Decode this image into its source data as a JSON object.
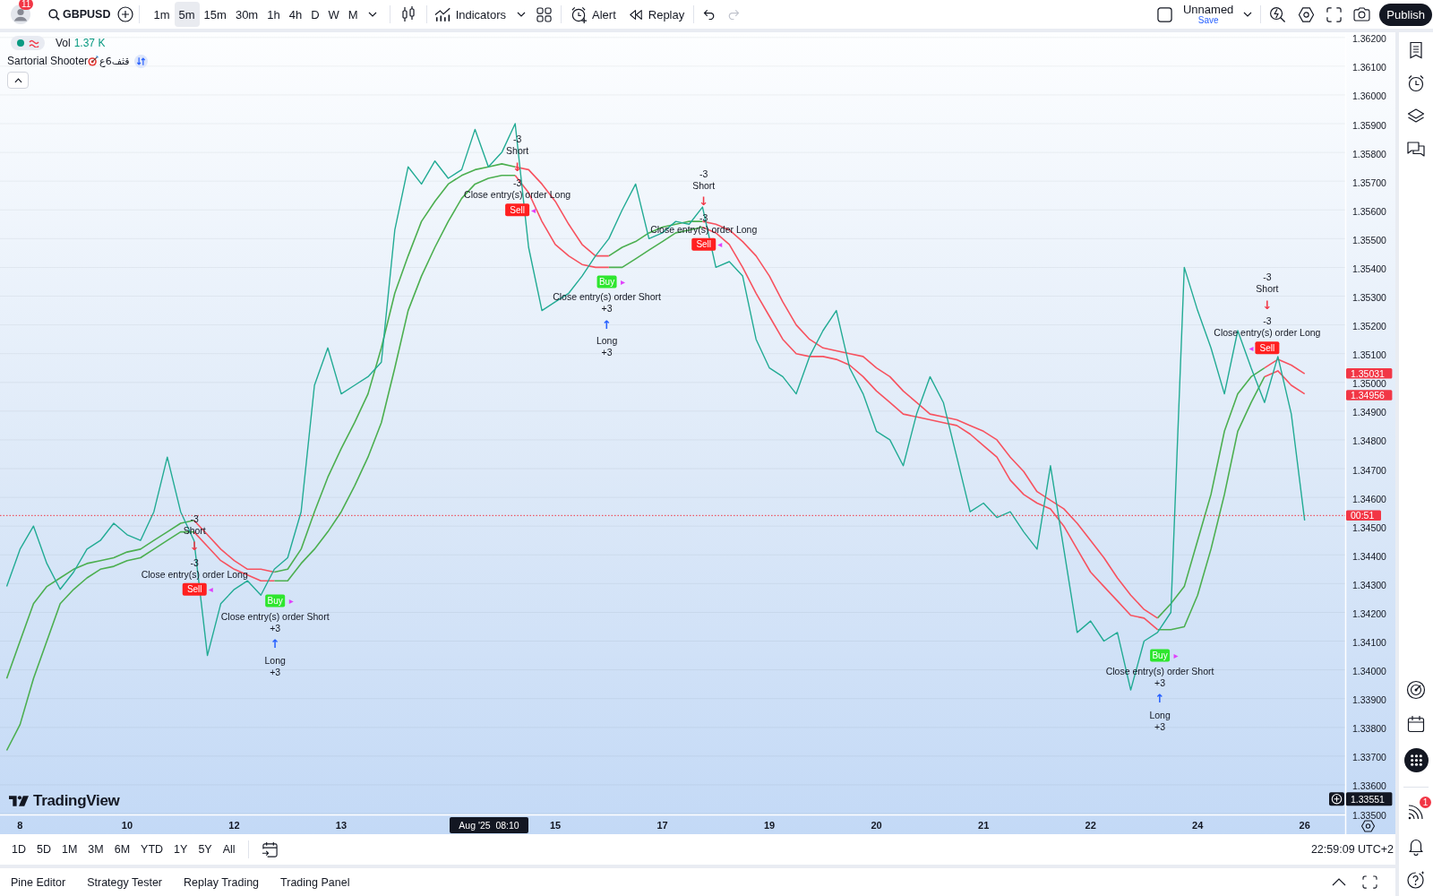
{
  "toolbar": {
    "notification_count": "11",
    "symbol": "GBPUSD",
    "intervals": [
      {
        "label": "1m",
        "selected": false
      },
      {
        "label": "5m",
        "selected": true
      },
      {
        "label": "15m",
        "selected": false
      },
      {
        "label": "30m",
        "selected": false
      },
      {
        "label": "1h",
        "selected": false
      },
      {
        "label": "4h",
        "selected": false
      },
      {
        "label": "D",
        "selected": false
      },
      {
        "label": "W",
        "selected": false
      },
      {
        "label": "M",
        "selected": false
      }
    ],
    "indicators": "Indicators",
    "alert": "Alert",
    "replay": "Replay",
    "history": [
      {
        "kind": "undo",
        "disabled": false
      },
      {
        "kind": "redo",
        "disabled": true
      }
    ],
    "layout_name": "Unnamed",
    "save": "Save",
    "publish": "Publish"
  },
  "legend": {
    "volume_label": "Vol",
    "volume_value": "1.37 K",
    "strategy_name": "Sartorial Shooter",
    "strategy_suffix": "قثف6ع"
  },
  "chart": {
    "logo_text": "TradingView",
    "chart_data": {
      "type": "line",
      "grid": true,
      "ylim": [
        1.33497,
        1.36218
      ],
      "categories": [
        null,
        "8",
        null,
        null,
        null,
        null,
        null,
        null,
        null,
        "10",
        null,
        null,
        null,
        null,
        null,
        null,
        null,
        "12",
        null,
        null,
        null,
        null,
        null,
        null,
        null,
        "13",
        null,
        null,
        null,
        null,
        null,
        null,
        null,
        null,
        null,
        null,
        null,
        null,
        null,
        null,
        null,
        "15",
        null,
        null,
        null,
        null,
        null,
        null,
        null,
        "17",
        null,
        null,
        null,
        null,
        null,
        null,
        null,
        "19",
        null,
        null,
        null,
        null,
        null,
        null,
        null,
        "20",
        null,
        null,
        null,
        null,
        null,
        null,
        null,
        "21",
        null,
        null,
        null,
        null,
        null,
        null,
        null,
        "22",
        null,
        null,
        null,
        null,
        null,
        null,
        null,
        "24",
        null,
        null,
        null,
        null,
        null,
        null,
        null,
        "26"
      ],
      "yticks": [
        {
          "value": 1.362,
          "label": "1.36200"
        },
        {
          "value": 1.361,
          "label": "1.36100"
        },
        {
          "value": 1.36,
          "label": "1.36000"
        },
        {
          "value": 1.359,
          "label": "1.35900"
        },
        {
          "value": 1.358,
          "label": "1.35800"
        },
        {
          "value": 1.357,
          "label": "1.35700"
        },
        {
          "value": 1.356,
          "label": "1.35600"
        },
        {
          "value": 1.355,
          "label": "1.35500"
        },
        {
          "value": 1.354,
          "label": "1.35400"
        },
        {
          "value": 1.353,
          "label": "1.35300"
        },
        {
          "value": 1.352,
          "label": "1.35200"
        },
        {
          "value": 1.351,
          "label": "1.35100"
        },
        {
          "value": 1.35,
          "label": "1.35000"
        },
        {
          "value": 1.349,
          "label": "1.34900"
        },
        {
          "value": 1.348,
          "label": "1.34800"
        },
        {
          "value": 1.347,
          "label": "1.34700"
        },
        {
          "value": 1.346,
          "label": "1.34600"
        },
        {
          "value": 1.345,
          "label": "1.34500"
        },
        {
          "value": 1.344,
          "label": "1.34400"
        },
        {
          "value": 1.343,
          "label": "1.34300"
        },
        {
          "value": 1.342,
          "label": "1.34200"
        },
        {
          "value": 1.341,
          "label": "1.34100"
        },
        {
          "value": 1.34,
          "label": "1.34000"
        },
        {
          "value": 1.339,
          "label": "1.33900"
        },
        {
          "value": 1.338,
          "label": "1.33800"
        },
        {
          "value": 1.337,
          "label": "1.33700"
        },
        {
          "value": 1.336,
          "label": "1.33600"
        },
        {
          "value": 1.335,
          "label": "1.33500"
        }
      ],
      "series": [
        {
          "color": "#22ab94",
          "values": [
            1.3429,
            1.3442,
            1.345,
            1.3437,
            1.3428,
            1.3434,
            1.3442,
            1.3445,
            1.3451,
            1.3447,
            1.3445,
            1.3455,
            1.3474,
            1.3455,
            1.3445,
            1.3405,
            1.3423,
            1.3428,
            1.3431,
            1.3426,
            1.3435,
            1.3439,
            1.3455,
            1.3499,
            1.3512,
            1.3496,
            1.3499,
            1.3502,
            1.3507,
            1.3553,
            1.3575,
            1.3569,
            1.3577,
            1.3571,
            1.3574,
            1.3588,
            1.3575,
            1.358,
            1.359,
            1.3547,
            1.3525,
            1.3528,
            1.3531,
            1.3537,
            1.3544,
            1.355,
            1.356,
            1.3569,
            1.355,
            1.3552,
            1.3556,
            1.3555,
            1.3561,
            1.354,
            1.3542,
            1.3537,
            1.3515,
            1.3505,
            1.3502,
            1.3496,
            1.3509,
            1.3518,
            1.3525,
            1.3505,
            1.3496,
            1.3483,
            1.348,
            1.3471,
            1.3489,
            1.3502,
            1.3493,
            1.3474,
            1.3455,
            1.3458,
            1.3453,
            1.3455,
            1.3448,
            1.3442,
            1.3471,
            1.3442,
            1.3413,
            1.3417,
            1.341,
            1.3413,
            1.3393,
            1.341,
            1.3413,
            1.342,
            1.354,
            1.3525,
            1.3512,
            1.3496,
            1.3518,
            1.3505,
            1.3493,
            1.3509,
            1.3489,
            1.3452
          ]
        },
        {
          "color": "#4caf50",
          "values": [
            1.3397,
            1.341,
            1.3423,
            1.3429,
            1.3432,
            1.3435,
            1.3437,
            1.3438,
            1.3439,
            1.3441,
            1.3442,
            1.3445,
            1.3448,
            1.3451,
            1.3452,
            null,
            null,
            null,
            null,
            null,
            1.3434,
            1.3435,
            1.3442,
            1.3455,
            1.3467,
            1.3477,
            1.3486,
            1.3496,
            1.3512,
            1.3531,
            1.3544,
            1.3556,
            1.3563,
            1.3569,
            1.3572,
            1.3574,
            1.3575,
            1.3576,
            1.3575,
            null,
            null,
            null,
            null,
            null,
            null,
            1.3544,
            1.3547,
            1.3549,
            1.3552,
            1.3554,
            1.3555,
            1.3556,
            1.3556,
            null,
            null,
            null,
            null,
            null,
            null,
            null,
            null,
            null,
            null,
            null,
            null,
            null,
            null,
            null,
            null,
            null,
            null,
            null,
            null,
            null,
            null,
            null,
            null,
            null,
            null,
            null,
            null,
            null,
            null,
            null,
            null,
            null,
            1.3418,
            1.3423,
            1.3429,
            1.3445,
            1.3461,
            1.3483,
            1.3496,
            1.3502,
            1.3505,
            null,
            null,
            null
          ]
        },
        {
          "color": "#4caf50",
          "values": [
            1.3372,
            1.3381,
            1.3397,
            1.341,
            1.3423,
            1.3428,
            1.3432,
            1.3435,
            1.3436,
            1.3438,
            1.3439,
            1.3442,
            1.3445,
            1.3448,
            1.3448,
            null,
            null,
            null,
            null,
            null,
            1.3431,
            1.3431,
            1.3437,
            1.3442,
            1.3448,
            1.3455,
            1.3464,
            1.3474,
            1.3486,
            1.3505,
            1.3525,
            1.3537,
            1.3547,
            1.3556,
            1.3564,
            1.3569,
            1.3571,
            1.3572,
            1.3572,
            null,
            null,
            null,
            null,
            null,
            null,
            1.354,
            1.354,
            1.3543,
            1.3546,
            1.3549,
            1.3552,
            1.3553,
            1.3554,
            null,
            null,
            null,
            null,
            null,
            null,
            null,
            null,
            null,
            null,
            null,
            null,
            null,
            null,
            null,
            null,
            null,
            null,
            null,
            null,
            null,
            null,
            null,
            null,
            null,
            null,
            null,
            null,
            null,
            null,
            null,
            null,
            null,
            1.3414,
            1.3414,
            1.3415,
            1.3426,
            1.3442,
            1.3461,
            1.3483,
            1.3493,
            1.3502,
            null,
            null,
            null
          ]
        },
        {
          "color": "#f7525f",
          "values": [
            null,
            null,
            null,
            null,
            null,
            null,
            null,
            null,
            null,
            null,
            null,
            null,
            null,
            null,
            1.3452,
            1.3447,
            1.3442,
            1.3438,
            1.3435,
            1.3435,
            1.3434,
            null,
            null,
            null,
            null,
            null,
            null,
            null,
            null,
            null,
            null,
            null,
            null,
            null,
            null,
            null,
            null,
            null,
            1.3575,
            1.3574,
            1.3569,
            1.3563,
            1.3555,
            1.3548,
            1.3544,
            1.3544,
            null,
            null,
            null,
            null,
            null,
            null,
            1.3556,
            1.3555,
            1.3553,
            1.3549,
            1.3544,
            1.3537,
            1.3528,
            1.352,
            1.3515,
            1.3512,
            1.3511,
            1.351,
            1.3509,
            1.3505,
            1.3502,
            1.3497,
            1.3493,
            1.3489,
            1.3488,
            1.3487,
            1.3485,
            1.3483,
            1.348,
            1.3474,
            1.3469,
            1.3462,
            1.3459,
            1.3456,
            1.3451,
            1.3445,
            1.3439,
            1.3432,
            1.3426,
            1.3421,
            1.3418,
            null,
            null,
            null,
            null,
            null,
            null,
            null,
            1.3505,
            1.3508,
            1.3506,
            1.3503
          ]
        },
        {
          "color": "#f7525f",
          "values": [
            null,
            null,
            null,
            null,
            null,
            null,
            null,
            null,
            null,
            null,
            null,
            null,
            null,
            null,
            1.3448,
            1.3443,
            1.3438,
            1.3435,
            1.3433,
            1.3431,
            1.3431,
            null,
            null,
            null,
            null,
            null,
            null,
            null,
            null,
            null,
            null,
            null,
            null,
            null,
            null,
            null,
            null,
            null,
            1.3572,
            1.3566,
            1.3556,
            1.3548,
            1.3544,
            1.3541,
            1.354,
            1.354,
            null,
            null,
            null,
            null,
            null,
            null,
            1.3554,
            1.3552,
            1.3548,
            1.354,
            1.3531,
            1.3523,
            1.3515,
            1.351,
            1.3509,
            1.3509,
            1.3508,
            1.3506,
            1.3502,
            1.3497,
            1.3493,
            1.3489,
            1.3488,
            1.3487,
            1.3486,
            1.3485,
            1.3482,
            1.3478,
            1.3474,
            1.3466,
            1.3461,
            1.3458,
            1.3456,
            1.345,
            1.3442,
            1.3434,
            1.3429,
            1.3424,
            1.3419,
            1.3418,
            1.3414,
            null,
            null,
            null,
            null,
            null,
            null,
            null,
            1.3502,
            1.3504,
            1.3499,
            1.3496
          ]
        }
      ],
      "annotations": [
        "-3",
        "Short",
        "↓",
        "-3",
        "Close entry(s) order Long",
        "Sell",
        "◂",
        "▸",
        "Buy",
        "Close entry(s) order Short",
        "+3",
        "↑",
        "Long",
        "+3",
        "-3",
        "Short",
        "↓",
        "-3",
        "Close entry(s) order Long",
        "Sell",
        "◂",
        "▸",
        "Buy",
        "Close entry(s) order Short",
        "+3",
        "↑",
        "Long",
        "+3",
        "-3",
        "Short",
        "↓",
        "-3",
        "Close entry(s) order Long",
        "Sell",
        "◂",
        "▸",
        "Buy",
        "Close entry(s) order Short",
        "+3",
        "↑",
        "Long",
        "+3",
        "-3",
        "Short",
        "↓",
        "-3",
        "Close entry(s) order Long",
        "Sell",
        "◂"
      ],
      "ref_lines": [
        {
          "axis": "y",
          "value": 1.34537,
          "color": "#f23645"
        }
      ]
    },
    "price_axis_tags": [
      {
        "label": "1.35031",
        "color": "#f23645",
        "crosshair": false
      },
      {
        "label": "1.34956",
        "color": "#f23645",
        "crosshair": false
      },
      {
        "label": "00:51",
        "color": "#f23645",
        "crosshair": false
      },
      {
        "label": "1.33551",
        "color": "#131722",
        "crosshair": true
      }
    ],
    "crosshair_time": "Aug '25  08:10"
  },
  "range_bar": {
    "ranges": [
      "1D",
      "5D",
      "1M",
      "3M",
      "6M",
      "YTD",
      "1Y",
      "5Y",
      "All"
    ],
    "clock": "22:59:09 UTC+2"
  },
  "bottom_tabs": [
    "Pine Editor",
    "Strategy Tester",
    "Replay Trading",
    "Trading Panel"
  ],
  "sidebar": {
    "notification_count": "1"
  }
}
